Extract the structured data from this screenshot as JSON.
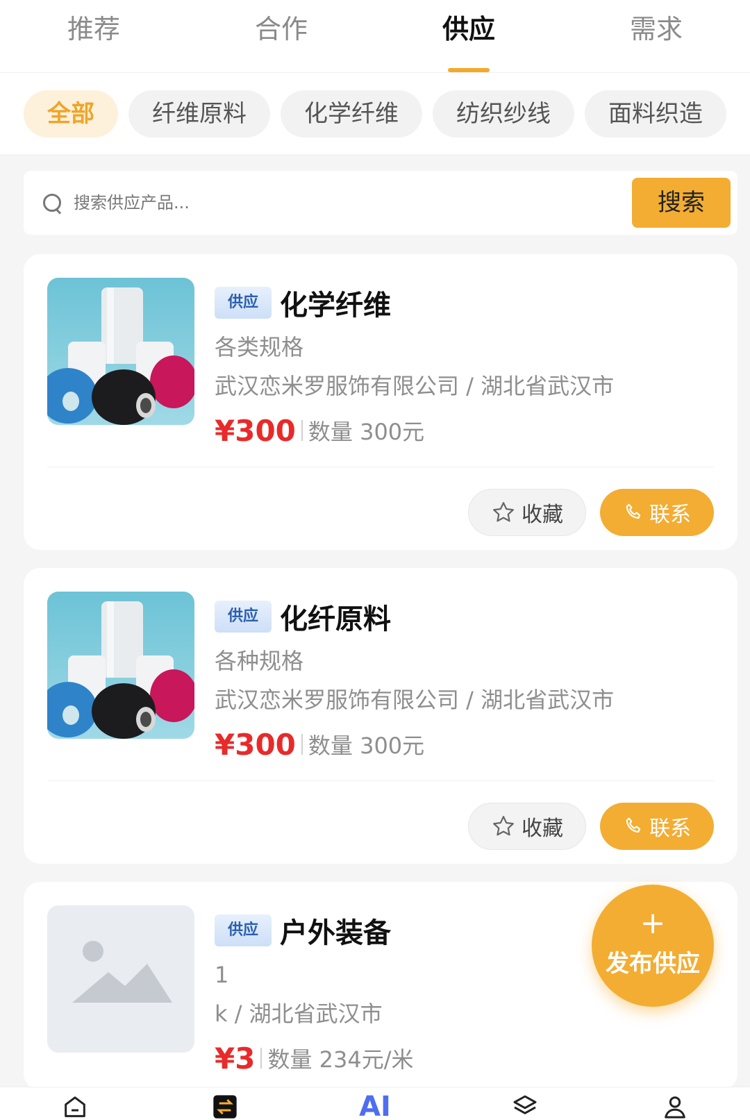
{
  "top_tabs": [
    {
      "label": "推荐"
    },
    {
      "label": "合作"
    },
    {
      "label": "供应"
    },
    {
      "label": "需求"
    }
  ],
  "active_tab": "供应",
  "categories": [
    {
      "label": "全部"
    },
    {
      "label": "纤维原料"
    },
    {
      "label": "化学纤维"
    },
    {
      "label": "纺织纱线"
    },
    {
      "label": "面料织造"
    }
  ],
  "search": {
    "placeholder": "搜索供应产品...",
    "button_label": "搜索"
  },
  "cards": [
    {
      "badge": "供应",
      "title": "化学纤维",
      "spec": "各类规格",
      "company": "武汉恋米罗服饰有限公司 / 湖北省武汉市",
      "price": "¥300",
      "quantity": "数量 300元",
      "favorite_label": "收藏",
      "contact_label": "联系",
      "image": "fiber-spools-photo"
    },
    {
      "badge": "供应",
      "title": "化纤原料",
      "spec": "各种规格",
      "company": "武汉恋米罗服饰有限公司 / 湖北省武汉市",
      "price": "¥300",
      "quantity": "数量 300元",
      "favorite_label": "收藏",
      "contact_label": "联系",
      "image": "fiber-spools-photo"
    },
    {
      "badge": "供应",
      "title": "户外装备",
      "spec": "1",
      "company": "k / 湖北省武汉市",
      "price": "¥3",
      "quantity": "数量 234元/米",
      "image": "image-placeholder-icon"
    }
  ],
  "fab": {
    "icon": "plus-icon",
    "label": "发布供应"
  },
  "bottom_nav": [
    {
      "icon": "home-icon"
    },
    {
      "icon": "exchange-icon"
    },
    {
      "icon": "ai-icon",
      "label": "AI"
    },
    {
      "icon": "layers-icon"
    },
    {
      "icon": "user-icon"
    }
  ],
  "colors": {
    "accent": "#f3ad33",
    "price": "#e82a2a",
    "badge_text": "#2b5fae"
  }
}
